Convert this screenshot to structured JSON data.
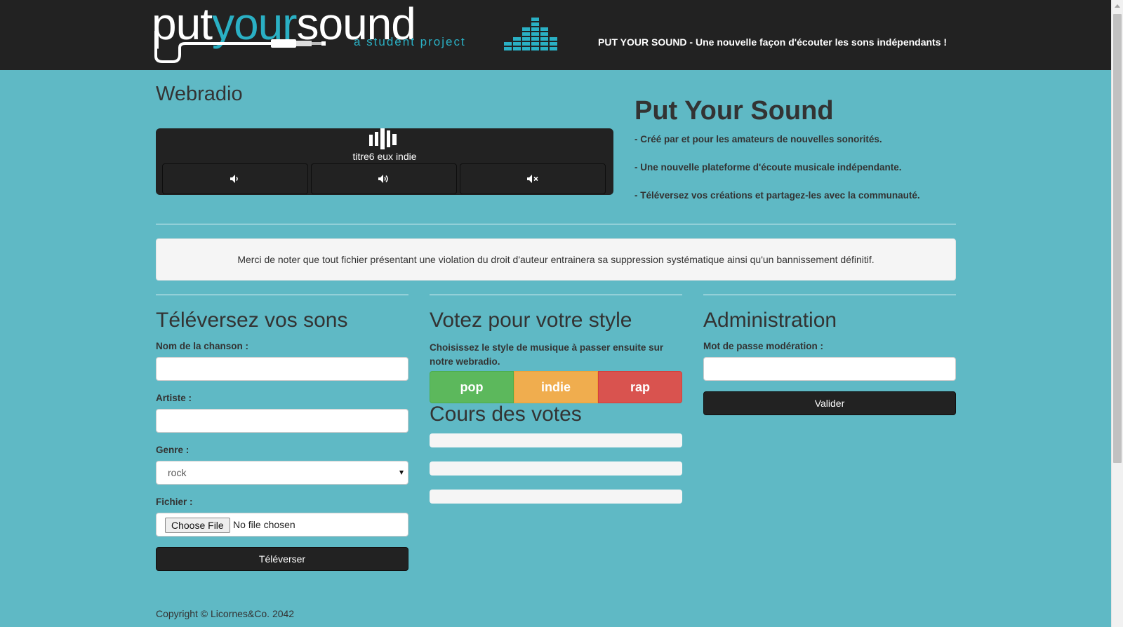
{
  "header": {
    "logo": {
      "word_put": "put",
      "word_your": "your",
      "word_sound": "sound",
      "subtitle": "a student project"
    },
    "tagline": "PUT YOUR SOUND - Une nouvelle façon d'écouter les sons indépendants !"
  },
  "webradio": {
    "title": "Webradio",
    "now_playing": "titre6 eux indie",
    "buttons": [
      {
        "icon": "volume-down-icon"
      },
      {
        "icon": "volume-up-icon"
      },
      {
        "icon": "volume-mute-icon"
      }
    ]
  },
  "about": {
    "title": "Put Your Sound",
    "lines": [
      "- Créé par et pour les amateurs de nouvelles sonorités.",
      "- Une nouvelle plateforme d'écoute musicale indépendante.",
      "- Téléversez vos créations et partagez-les avec la communauté."
    ]
  },
  "notice": "Merci de noter que tout fichier présentant une violation du droit d'auteur entrainera sa suppression systématique ainsi qu'un bannissement définitif.",
  "upload": {
    "title": "Téléversez vos sons",
    "song_label": "Nom de la chanson :",
    "song_value": "",
    "artist_label": "Artiste :",
    "artist_value": "",
    "genre_label": "Genre :",
    "genre_value": "rock",
    "file_label": "Fichier :",
    "file_button": "Choose File",
    "file_status": "No file chosen",
    "submit": "Téléverser"
  },
  "vote": {
    "title": "Votez pour votre style",
    "description": "Choisissez le style de musique à passer ensuite sur notre webradio.",
    "options": [
      {
        "label": "pop",
        "color": "#5cb85c"
      },
      {
        "label": "indie",
        "color": "#f0ad4e"
      },
      {
        "label": "rap",
        "color": "#d9534f"
      }
    ],
    "results_title": "Cours des votes",
    "results": [
      0,
      0,
      0
    ]
  },
  "admin": {
    "title": "Administration",
    "password_label": "Mot de passe modération :",
    "password_value": "",
    "submit": "Valider"
  },
  "footer": {
    "copyright": "Copyright © Licornes&Co. 2042"
  },
  "colors": {
    "background": "#5fb9c5",
    "header": "#222222",
    "accent": "#2ab0c4"
  }
}
